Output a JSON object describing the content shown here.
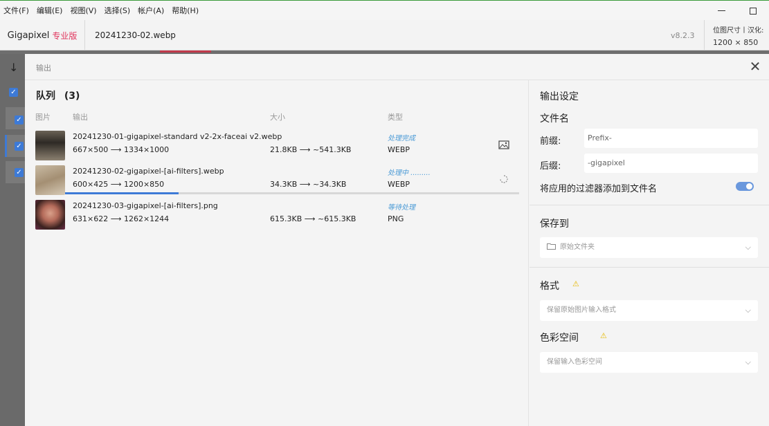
{
  "menu": [
    "文件(F)",
    "编辑(E)",
    "视图(V)",
    "选择(S)",
    "帐户(A)",
    "帮助(H)"
  ],
  "app": {
    "brand": "Gigapixel",
    "brand_edition": "专业版",
    "current_file": "20241230-02.webp",
    "version": "v8.2.3",
    "size_label": "位图尺寸丨汉化:",
    "size_value": "1200 × 850"
  },
  "modal": {
    "title": "输出",
    "close_icon": "close-icon",
    "queue": {
      "title": "队列",
      "count": "(3)",
      "columns": [
        "图片",
        "输出",
        "大小",
        "类型"
      ],
      "items": [
        {
          "filename": "20241230-01-gigapixel-standard v2-2x-faceai v2.webp",
          "dims": "667×500 ⟶ 1334×1000",
          "sizes": "21.8KB ⟶ ~541.3KB",
          "status": "处理完成",
          "type": "WEBP",
          "icon": "open-folder-image-icon"
        },
        {
          "filename": "20241230-02-gigapixel-[ai-filters].webp",
          "dims": "600×425 ⟶ 1200×850",
          "sizes": "34.3KB ⟶ ~34.3KB",
          "status": "处理中 .........",
          "type": "WEBP",
          "icon": "spinner-icon",
          "progress": 0.25
        },
        {
          "filename": "20241230-03-gigapixel-[ai-filters].png",
          "dims": "631×622 ⟶ 1262×1244",
          "sizes": "615.3KB ⟶ ~615.3KB",
          "status": "等待处理",
          "type": "PNG"
        }
      ]
    },
    "settings": {
      "title": "输出设定",
      "filename_section": "文件名",
      "prefix_label": "前缀:",
      "prefix_value": "Prefix-",
      "suffix_label": "后缀:",
      "suffix_value": "-gigapixel",
      "append_filters_label": "将应用的过滤器添加到文件名",
      "append_filters_on": true,
      "save_to_title": "保存到",
      "save_to_value": "原始文件夹",
      "format_title": "格式",
      "format_value": "保留原始图片输入格式",
      "colorspace_title": "色彩空间",
      "colorspace_value": "保留输入色彩空间"
    }
  },
  "colors": {
    "accent": "#3d7ad6",
    "brand_edition": "#e0345c",
    "status": "#4a9ad6",
    "warning": "#e6b800"
  }
}
